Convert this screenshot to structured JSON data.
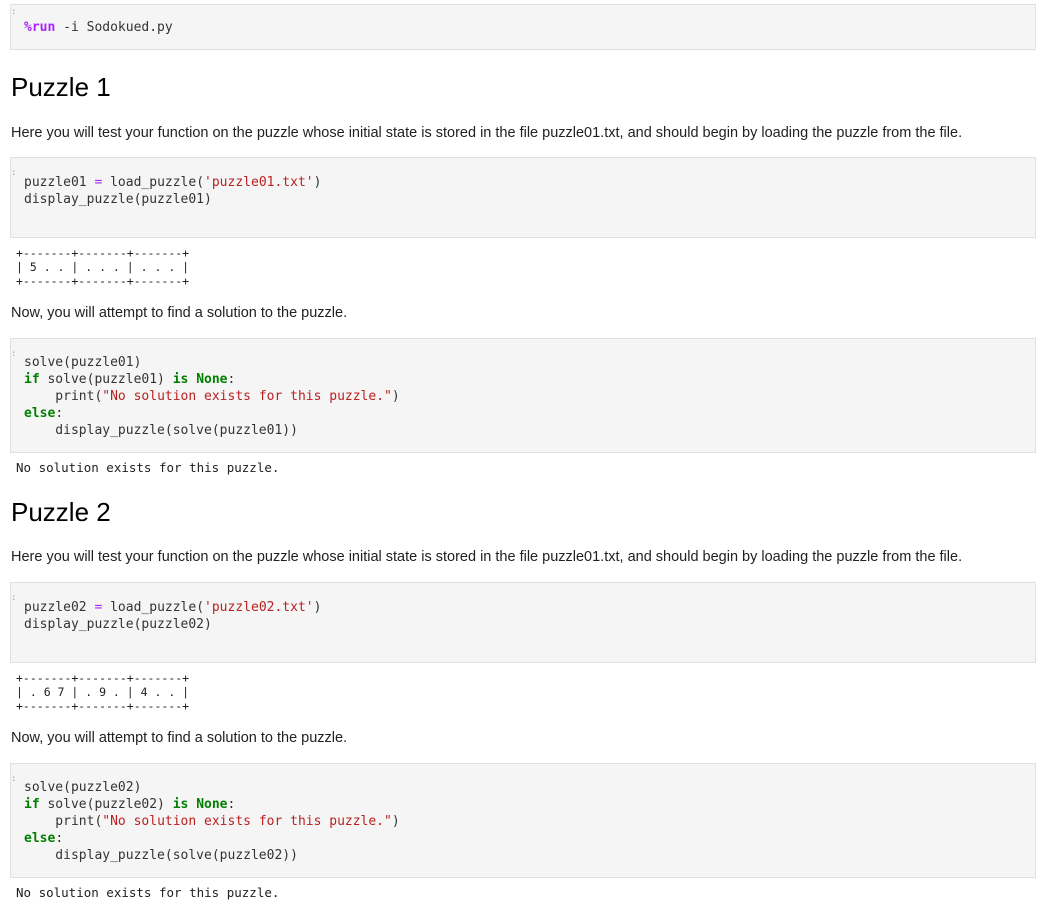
{
  "cell_run": {
    "magic": "%run",
    "args": " -i Sodokued.py"
  },
  "puzzle1": {
    "heading": "Puzzle 1",
    "intro": "Here you will test your function on the puzzle whose initial state is stored in the file puzzle01.txt, and should begin by loading the puzzle from the file.",
    "load_var": "puzzle01",
    "load_fn": "load_puzzle(",
    "load_file": "'puzzle01.txt'",
    "display_line": "display_puzzle(puzzle01)",
    "grid_border": "+-------+-------+-------+",
    "grid_row": "| 5 . . | . . . | . . . |",
    "solve_prompt": "Now, you will attempt to find a solution to the puzzle.",
    "solve_call": "solve(puzzle01)",
    "if_cond": " solve(puzzle01) ",
    "print_msg": "\"No solution exists for this puzzle.\"",
    "else_body": "    display_puzzle(solve(puzzle01))",
    "output": "No solution exists for this puzzle."
  },
  "puzzle2": {
    "heading": "Puzzle 2",
    "intro": "Here you will test your function on the puzzle whose initial state is stored in the file puzzle01.txt, and should begin by loading the puzzle from the file.",
    "load_var": "puzzle02",
    "load_fn": "load_puzzle(",
    "load_file": "'puzzle02.txt'",
    "display_line": "display_puzzle(puzzle02)",
    "grid_border": "+-------+-------+-------+",
    "grid_row": "| . 6 7 | . 9 . | 4 . . |",
    "solve_prompt": "Now, you will attempt to find a solution to the puzzle.",
    "solve_call": "solve(puzzle02)",
    "if_cond": " solve(puzzle02) ",
    "print_msg": "\"No solution exists for this puzzle.\"",
    "else_body": "    display_puzzle(solve(puzzle02))",
    "output": "No solution exists for this puzzle."
  },
  "syntax": {
    "kw_if": "if",
    "kw_is": "is",
    "kw_none": "None",
    "kw_else": "else",
    "colon": ":",
    "print_open": "    print(",
    "print_close": ")",
    "eq": " = ",
    "close_paren": ")",
    "tick": ":"
  }
}
